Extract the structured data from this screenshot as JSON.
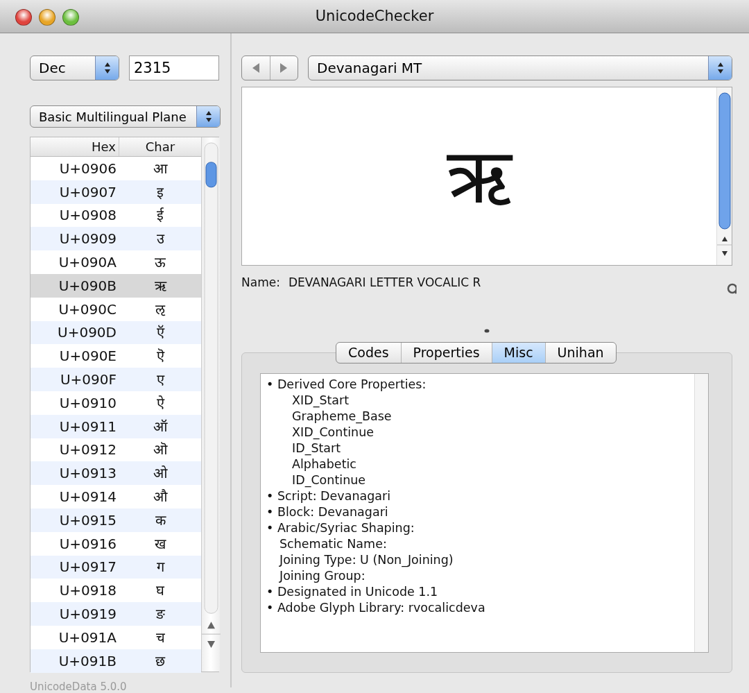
{
  "window": {
    "title": "UnicodeChecker"
  },
  "radix_select": {
    "value": "Dec"
  },
  "code_field": {
    "value": "2315"
  },
  "plane_select": {
    "value": "Basic Multilingual Plane"
  },
  "table": {
    "columns": [
      "Hex",
      "Char"
    ],
    "rows": [
      {
        "hex": "U+0906",
        "char": "आ",
        "selected": false
      },
      {
        "hex": "U+0907",
        "char": "इ",
        "selected": false
      },
      {
        "hex": "U+0908",
        "char": "ई",
        "selected": false
      },
      {
        "hex": "U+0909",
        "char": "उ",
        "selected": false
      },
      {
        "hex": "U+090A",
        "char": "ऊ",
        "selected": false
      },
      {
        "hex": "U+090B",
        "char": "ऋ",
        "selected": true
      },
      {
        "hex": "U+090C",
        "char": "ऌ",
        "selected": false
      },
      {
        "hex": "U+090D",
        "char": "ऍ",
        "selected": false
      },
      {
        "hex": "U+090E",
        "char": "ऎ",
        "selected": false
      },
      {
        "hex": "U+090F",
        "char": "ए",
        "selected": false
      },
      {
        "hex": "U+0910",
        "char": "ऐ",
        "selected": false
      },
      {
        "hex": "U+0911",
        "char": "ऑ",
        "selected": false
      },
      {
        "hex": "U+0912",
        "char": "ऒ",
        "selected": false
      },
      {
        "hex": "U+0913",
        "char": "ओ",
        "selected": false
      },
      {
        "hex": "U+0914",
        "char": "औ",
        "selected": false
      },
      {
        "hex": "U+0915",
        "char": "क",
        "selected": false
      },
      {
        "hex": "U+0916",
        "char": "ख",
        "selected": false
      },
      {
        "hex": "U+0917",
        "char": "ग",
        "selected": false
      },
      {
        "hex": "U+0918",
        "char": "घ",
        "selected": false
      },
      {
        "hex": "U+0919",
        "char": "ङ",
        "selected": false
      },
      {
        "hex": "U+091A",
        "char": "च",
        "selected": false
      },
      {
        "hex": "U+091B",
        "char": "छ",
        "selected": false
      }
    ]
  },
  "footer": "UnicodeData 5.0.0",
  "font_select": {
    "value": "Devanagari MT"
  },
  "preview": {
    "glyph": "ऋ"
  },
  "name": {
    "label": "Name:",
    "value": "DEVANAGARI LETTER VOCALIC R"
  },
  "tabs": [
    {
      "label": "Codes",
      "selected": false
    },
    {
      "label": "Properties",
      "selected": false
    },
    {
      "label": "Misc",
      "selected": true
    },
    {
      "label": "Unihan",
      "selected": false
    }
  ],
  "misc": {
    "lines": [
      {
        "text": "• Derived Core Properties:",
        "children": [
          {
            "text": "XID_Start",
            "kind": "property"
          },
          {
            "text": "Grapheme_Base",
            "kind": "property"
          },
          {
            "text": "XID_Continue",
            "kind": "property"
          },
          {
            "text": "ID_Start",
            "kind": "property"
          },
          {
            "text": "Alphabetic",
            "kind": "property"
          },
          {
            "text": "ID_Continue",
            "kind": "property"
          }
        ]
      },
      {
        "text": "• Script: Devanagari"
      },
      {
        "text": "• Block: Devanagari"
      },
      {
        "text": "• Arabic/Syriac Shaping:",
        "children": [
          {
            "text": "Schematic Name:",
            "kind": "field"
          },
          {
            "text": "Joining Type: U (Non_Joining)",
            "kind": "field"
          },
          {
            "text": "Joining Group:",
            "kind": "field"
          }
        ]
      },
      {
        "text": "• Designated in Unicode 1.1"
      },
      {
        "text": "• Adobe Glyph Library: rvocalicdeva"
      }
    ]
  }
}
